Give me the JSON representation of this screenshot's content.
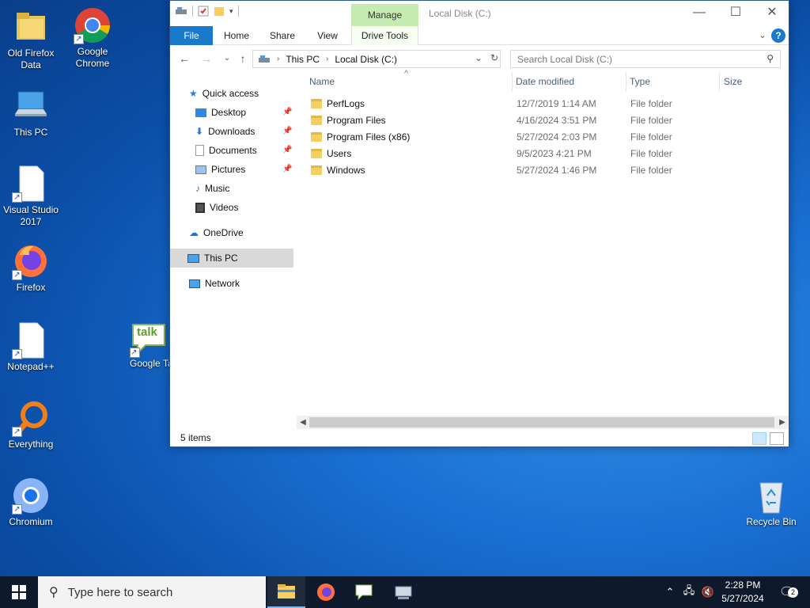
{
  "desktop": {
    "icons": [
      {
        "label": "Old Firefox Data",
        "icon": "folder-icon"
      },
      {
        "label": "Google Chrome",
        "icon": "chrome-icon"
      },
      {
        "label": "This PC",
        "icon": "computer-icon"
      },
      {
        "label": "Visual Studio 2017",
        "icon": "file-icon"
      },
      {
        "label": "Firefox",
        "icon": "firefox-icon"
      },
      {
        "label": "Notepad++",
        "icon": "file-icon"
      },
      {
        "label": "Google Ta",
        "icon": "talk-icon"
      },
      {
        "label": "Everything",
        "icon": "everything-icon"
      },
      {
        "label": "Chromium",
        "icon": "chromium-icon"
      },
      {
        "label": "Recycle Bin",
        "icon": "recycle-bin-icon"
      }
    ],
    "talk_bubble_text": "talk"
  },
  "window": {
    "title": "Local Disk (C:)",
    "manage_tab": "Manage",
    "ribbon_tabs": [
      "File",
      "Home",
      "Share",
      "View",
      "Drive Tools"
    ],
    "help_label": "?",
    "address": {
      "crumbs": [
        "This PC",
        "Local Disk (C:)"
      ]
    },
    "search_placeholder": "Search Local Disk (C:)",
    "nav_pane": {
      "quick_access": "Quick access",
      "pinned": [
        "Desktop",
        "Downloads",
        "Documents",
        "Pictures"
      ],
      "unpinned": [
        "Music",
        "Videos"
      ],
      "onedrive": "OneDrive",
      "this_pc": "This PC",
      "network": "Network"
    },
    "columns": [
      "Name",
      "Date modified",
      "Type",
      "Size"
    ],
    "files": [
      {
        "name": "PerfLogs",
        "date": "12/7/2019 1:14 AM",
        "type": "File folder"
      },
      {
        "name": "Program Files",
        "date": "4/16/2024 3:51 PM",
        "type": "File folder"
      },
      {
        "name": "Program Files (x86)",
        "date": "5/27/2024 2:03 PM",
        "type": "File folder"
      },
      {
        "name": "Users",
        "date": "9/5/2023 4:21 PM",
        "type": "File folder"
      },
      {
        "name": "Windows",
        "date": "5/27/2024 1:46 PM",
        "type": "File folder"
      }
    ],
    "status": "5 items"
  },
  "taskbar": {
    "search_placeholder": "Type here to search",
    "apps": [
      "file-explorer-icon",
      "firefox-icon",
      "talk-icon",
      "network-drive-icon"
    ],
    "time": "2:28 PM",
    "date": "5/27/2024",
    "notification_count": "2"
  },
  "colors": {
    "accent": "#1979ca",
    "manage_tab": "#c6ebb0",
    "taskbar": "#0e1a2b",
    "folder": "#f5cf61"
  }
}
